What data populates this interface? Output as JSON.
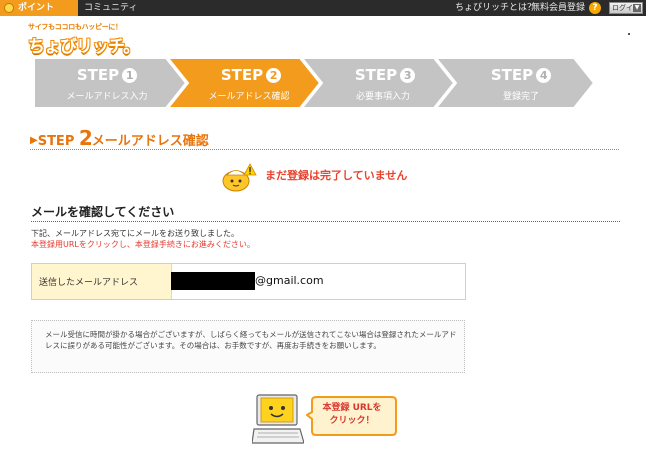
{
  "topbar": {
    "tab_point": "ポイント",
    "tab_community": "コミュニティ",
    "about_link": "ちょびリッチとは？",
    "register_link": "無料会員登録",
    "help_icon": "?",
    "login_button": "ログイン"
  },
  "logo": {
    "tagline": "サイフもココロもハッピーに！",
    "name": "ちょびリッチ。"
  },
  "steps": [
    {
      "title": "STEP",
      "num": "1",
      "label": "メールアドレス入力",
      "active": false
    },
    {
      "title": "STEP",
      "num": "2",
      "label": "メールアドレス確認",
      "active": true
    },
    {
      "title": "STEP",
      "num": "3",
      "label": "必要事項入力",
      "active": false
    },
    {
      "title": "STEP",
      "num": "4",
      "label": "登録完了",
      "active": false
    }
  ],
  "heading": {
    "prefix": "STEP",
    "num": "2",
    "text": "メールアドレス確認"
  },
  "warning": "まだ登録は完了していません",
  "section": {
    "title": "メールを確認してください",
    "instruction1": "下記、メールアドレス宛てにメールをお送り致しました。",
    "instruction2": "本登録用URLをクリックし、本登録手続きにお進みください。"
  },
  "email": {
    "label": "送信したメールアドレス",
    "domain": "@gmail.com"
  },
  "note": "メール受信に時間が掛かる場合がございますが、しばらく経ってもメールが送信されてこない場合は登録されたメールアドレスに誤りがある可能性がございます。その場合は、お手数ですが、再度お手続きをお願いします。",
  "callout": {
    "line1": "本登録 URLを",
    "line2": "クリック！"
  },
  "colors": {
    "accent": "#f29b1d",
    "step_inactive": "#c4c4c4",
    "warning_red": "#e8432d"
  }
}
